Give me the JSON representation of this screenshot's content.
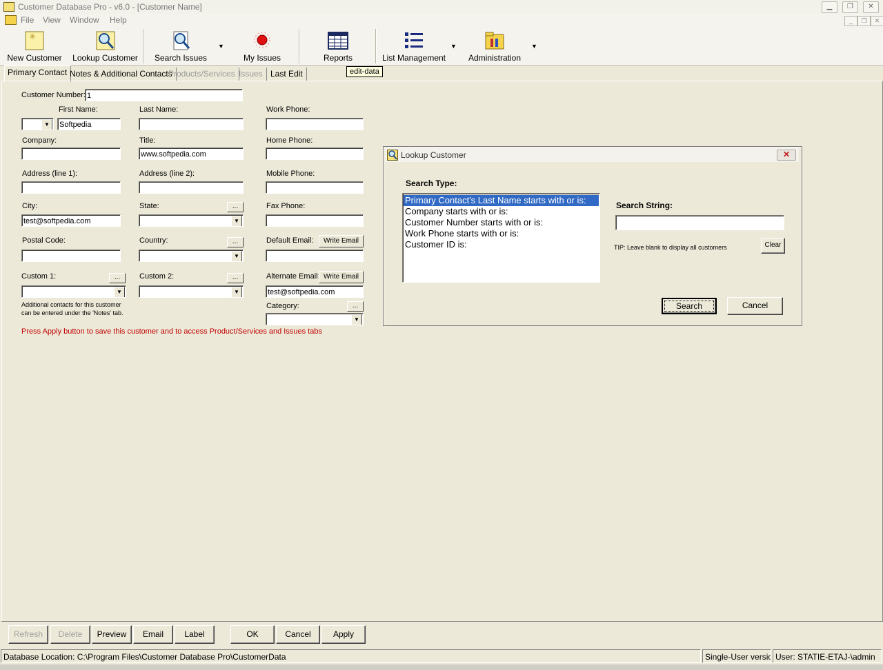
{
  "window": {
    "title": "Customer Database Pro - v6.0 - [Customer Name]"
  },
  "menu": [
    "File",
    "View",
    "Window",
    "Help"
  ],
  "toolbar": {
    "new_customer": "New Customer",
    "lookup_customer": "Lookup Customer",
    "search_issues": "Search Issues",
    "my_issues": "My Issues",
    "reports": "Reports",
    "list_management": "List Management",
    "administration": "Administration"
  },
  "tabs": {
    "primary_contact": "Primary Contact",
    "notes": "Notes & Additional Contacts",
    "products": "Products/Services",
    "issues": "Issues",
    "last_edit": "Last Edit"
  },
  "tooltip": "edit-data",
  "form": {
    "customer_number_label": "Customer Number:",
    "customer_number": "1",
    "first_name_label": "First Name:",
    "first_name": "Softpedia",
    "last_name_label": "Last Name:",
    "last_name": "",
    "work_phone_label": "Work Phone:",
    "company_label": "Company:",
    "title_label": "Title:",
    "title": "www.softpedia.com",
    "home_phone_label": "Home Phone:",
    "address1_label": "Address (line 1):",
    "address2_label": "Address (line 2):",
    "mobile_phone_label": "Mobile Phone:",
    "city_label": "City:",
    "city": "test@softpedia.com",
    "state_label": "State:",
    "fax_phone_label": "Fax Phone:",
    "postal_code_label": "Postal Code:",
    "country_label": "Country:",
    "default_email_label": "Default Email:",
    "write_email": "Write Email",
    "custom1_label": "Custom 1:",
    "custom2_label": "Custom 2:",
    "alternate_email_label": "Alternate Email:",
    "alternate_email": "test@softpedia.com",
    "category_label": "Category:",
    "ellipsis": "...",
    "additional_note_1": "Additional contacts for this customer",
    "additional_note_2": "can be entered under the 'Notes' tab.",
    "apply_notice": "Press Apply button to save this customer and to access Product/Services and Issues tabs"
  },
  "buttons": {
    "refresh": "Refresh",
    "delete": "Delete",
    "preview": "Preview",
    "email": "Email",
    "label": "Label",
    "ok": "OK",
    "cancel": "Cancel",
    "apply": "Apply"
  },
  "status": {
    "db_location": "Database Location: C:\\Program Files\\Customer Database Pro\\CustomerData",
    "version": "Single-User version",
    "user": "User: STATIE-ETAJ-\\admin"
  },
  "dialog": {
    "title": "Lookup Customer",
    "search_type_label": "Search Type:",
    "search_types": [
      "Primary Contact's Last Name starts with or is:",
      "Company starts with or is:",
      "Customer Number starts with or is:",
      "Work Phone starts with or is:",
      "Customer ID is:"
    ],
    "search_string_label": "Search String:",
    "search_string": "",
    "tip": "TIP: Leave blank to display all customers",
    "clear": "Clear",
    "search": "Search",
    "cancel": "Cancel"
  },
  "colors": {
    "selection": "#316ac5",
    "notice": "#c00000"
  }
}
